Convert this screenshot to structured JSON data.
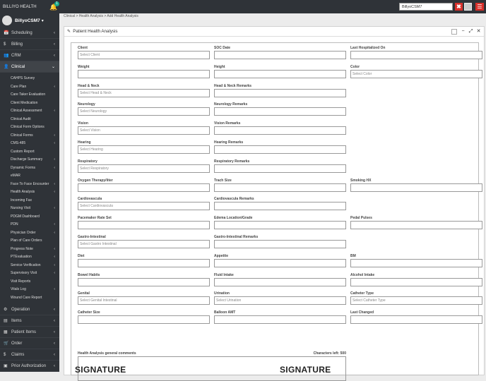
{
  "topbar": {
    "brand": "BILLIYO HEALTH",
    "notif_count": "1",
    "search_value": "BillyoCSM7",
    "close_glyph": "✖",
    "menu_glyph": "☰",
    "bell_glyph": "🔔"
  },
  "sidebar": {
    "username": "BillyoCSM7",
    "username_caret": "▾",
    "sections_top": [
      {
        "label": "Scheduling",
        "icon": "📅"
      },
      {
        "label": "Billing",
        "icon": "$"
      },
      {
        "label": "CRM",
        "icon": "👥"
      }
    ],
    "clinical": {
      "label": "Clinical",
      "icon": "👤"
    },
    "clinical_items": [
      {
        "label": "CAHPS Survey",
        "sub": false
      },
      {
        "label": "Care Plan",
        "sub": true
      },
      {
        "label": "Care Taker Evaluation",
        "sub": false
      },
      {
        "label": "Client Medication",
        "sub": false
      },
      {
        "label": "Clinical Assessment",
        "sub": true
      },
      {
        "label": "Clinical Audit",
        "sub": false
      },
      {
        "label": "Clinical Form Options",
        "sub": false
      },
      {
        "label": "Clinical Forms",
        "sub": true
      },
      {
        "label": "CMS-485",
        "sub": true
      },
      {
        "label": "Custom Report",
        "sub": false
      },
      {
        "label": "Discharge Summary",
        "sub": true
      },
      {
        "label": "Dynamic Forms",
        "sub": true
      },
      {
        "label": "eMAR",
        "sub": false
      },
      {
        "label": "Face To Face Encounter",
        "sub": true
      },
      {
        "label": "Health Analysis",
        "sub": true
      },
      {
        "label": "Incoming Fax",
        "sub": false
      },
      {
        "label": "Nursing Visit",
        "sub": true
      },
      {
        "label": "PDGM Dashboard",
        "sub": false
      },
      {
        "label": "PDN",
        "sub": true
      },
      {
        "label": "Physician Order",
        "sub": true
      },
      {
        "label": "Plan of Care Orders",
        "sub": false
      },
      {
        "label": "Progress Note",
        "sub": true
      },
      {
        "label": "PTEvaluation",
        "sub": true
      },
      {
        "label": "Service Verification",
        "sub": true
      },
      {
        "label": "Supervisory Visit",
        "sub": true
      },
      {
        "label": "Visit Reports",
        "sub": false
      },
      {
        "label": "Vitals Log",
        "sub": true
      },
      {
        "label": "Wound Care Report",
        "sub": false
      }
    ],
    "sections_bottom": [
      {
        "label": "Operation",
        "icon": "⚙"
      },
      {
        "label": "Items",
        "icon": "▤"
      },
      {
        "label": "Patient Items",
        "icon": "▦"
      },
      {
        "label": "Order",
        "icon": "🛒"
      },
      {
        "label": "Claims",
        "icon": "$"
      },
      {
        "label": "Prior Authorization",
        "icon": "▣"
      }
    ]
  },
  "breadcrumb": "Clinical > Health Analysis > Add Health Analysis",
  "panel": {
    "title": "Patient Health Analysis",
    "edit_icon": "✎",
    "min_glyph": "−",
    "expand_glyph": "⤢",
    "close_glyph": "✕"
  },
  "fields": [
    [
      {
        "label": "Client",
        "value": "",
        "placeholder": "Select Client"
      },
      {
        "label": "SOC Date",
        "value": "",
        "placeholder": ""
      },
      {
        "label": "Last Hospitalized On",
        "value": "",
        "placeholder": ""
      }
    ],
    [
      {
        "label": "Weight",
        "value": "",
        "placeholder": ""
      },
      {
        "label": "Height",
        "value": "",
        "placeholder": ""
      },
      {
        "label": "Color",
        "value": "",
        "placeholder": "Select Color"
      }
    ],
    [
      {
        "label": "Head & Neck",
        "value": "",
        "placeholder": "Select Head & Neck"
      },
      {
        "label": "Head & Neck Remarks",
        "value": "",
        "placeholder": ""
      }
    ],
    [
      {
        "label": "Neurology",
        "value": "",
        "placeholder": "Select Neurology"
      },
      {
        "label": "Neurology Remarks",
        "value": "",
        "placeholder": ""
      }
    ],
    [
      {
        "label": "Vision",
        "value": "",
        "placeholder": "Select Vision"
      },
      {
        "label": "Vision Remarks",
        "value": "",
        "placeholder": ""
      }
    ],
    [
      {
        "label": "Hearing",
        "value": "",
        "placeholder": "Select Hearing"
      },
      {
        "label": "Hearing Remarks",
        "value": "",
        "placeholder": ""
      }
    ],
    [
      {
        "label": "Respiratory",
        "value": "",
        "placeholder": "Select Respiratory"
      },
      {
        "label": "Respiratory Remarks",
        "value": "",
        "placeholder": ""
      }
    ],
    [
      {
        "label": "Oxygen Therapy/liter",
        "value": "",
        "placeholder": ""
      },
      {
        "label": "Trach Size",
        "value": "",
        "placeholder": ""
      },
      {
        "label": "Smoking HX",
        "value": "",
        "placeholder": ""
      }
    ],
    [
      {
        "label": "Cardiovascula",
        "value": "",
        "placeholder": "Select Cardiovascula"
      },
      {
        "label": "Cardiovascula Remarks",
        "value": "",
        "placeholder": ""
      }
    ],
    [
      {
        "label": "Pacemaker Rate Set",
        "value": "",
        "placeholder": ""
      },
      {
        "label": "Edema Location/Grade",
        "value": "",
        "placeholder": ""
      },
      {
        "label": "Pedal Pulses",
        "value": "",
        "placeholder": ""
      }
    ],
    [
      {
        "label": "Gastro-Intestinal",
        "value": "",
        "placeholder": "Select Gastro Intestinal"
      },
      {
        "label": "Gastro-Intestinal Remarks",
        "value": "",
        "placeholder": ""
      }
    ],
    [
      {
        "label": "Diet",
        "value": "",
        "placeholder": ""
      },
      {
        "label": "Appetite",
        "value": "",
        "placeholder": ""
      },
      {
        "label": "BM",
        "value": "",
        "placeholder": ""
      }
    ],
    [
      {
        "label": "Bowel Habits",
        "value": "",
        "placeholder": ""
      },
      {
        "label": "Fluid Intake",
        "value": "",
        "placeholder": ""
      },
      {
        "label": "Alcohol Intake",
        "value": "",
        "placeholder": ""
      }
    ],
    [
      {
        "label": "Genital",
        "value": "",
        "placeholder": "Select Genital Intestinal"
      },
      {
        "label": "Urination",
        "value": "",
        "placeholder": "Select Urination"
      },
      {
        "label": "Catheter Type",
        "value": "",
        "placeholder": "Select Catheter Type"
      }
    ],
    [
      {
        "label": "Catheter Size",
        "value": "",
        "placeholder": ""
      },
      {
        "label": "Balloon AMT",
        "value": "",
        "placeholder": ""
      },
      {
        "label": "Last Changed",
        "value": "",
        "placeholder": ""
      }
    ]
  ],
  "comments": {
    "label": "Health Analysis general comments",
    "counter": "Characters left: 500",
    "value": ""
  },
  "signatures": [
    "SIGNATURE",
    "SIGNATURE"
  ]
}
